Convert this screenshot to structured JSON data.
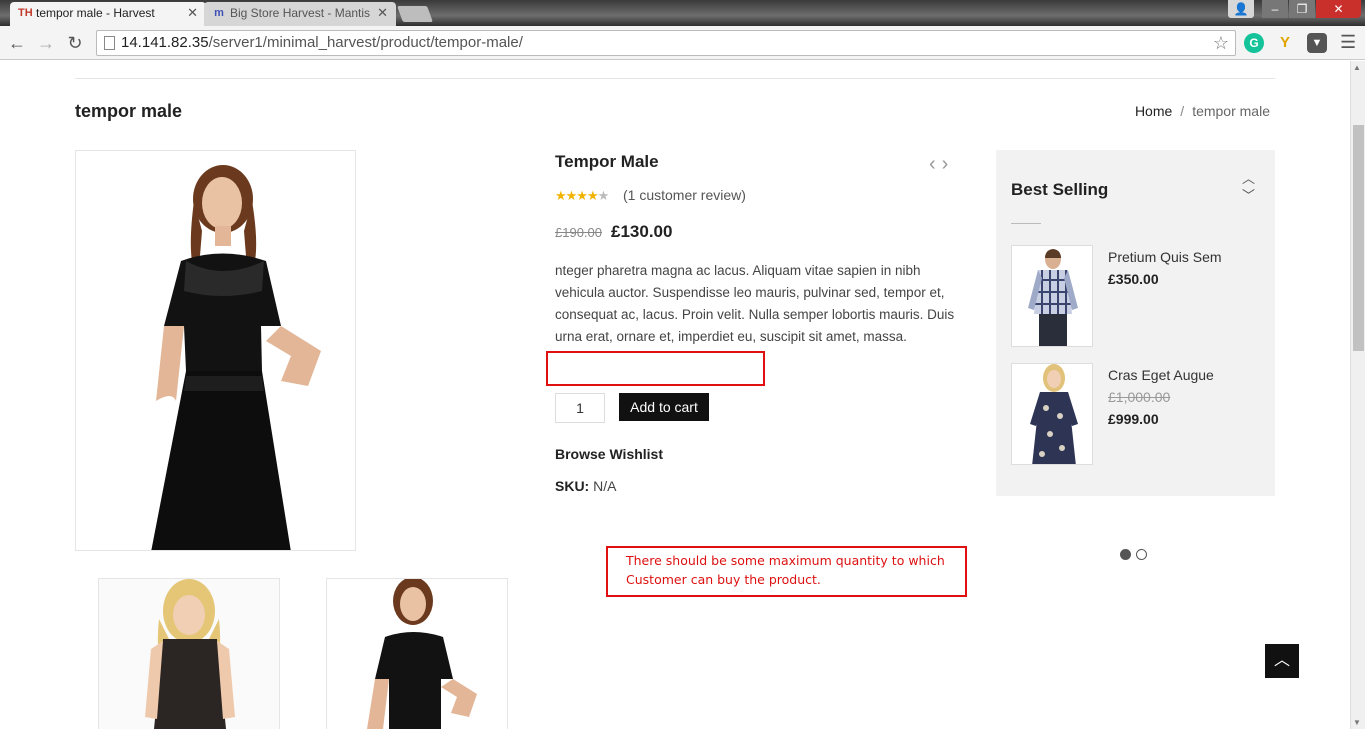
{
  "browser": {
    "tabs": [
      {
        "title": "tempor male - Harvest",
        "favicon": "TH"
      },
      {
        "title": "Big Store Harvest - Mantis",
        "favicon": "m"
      }
    ],
    "url": {
      "host": "14.141.82.35",
      "path": "/server1/minimal_harvest/product/tempor-male/"
    }
  },
  "page": {
    "title": "tempor male",
    "breadcrumb": {
      "home": "Home",
      "sep": "/",
      "current": "tempor male"
    }
  },
  "product": {
    "name": "Tempor Male",
    "rating": 4.5,
    "rating_stars": "★★★★",
    "rating_dim": "★",
    "reviews": "(1 customer review)",
    "price_old": "£190.00",
    "price_new": "£130.00",
    "description": "nteger pharetra magna ac lacus. Aliquam vitae sapien in nibh vehicula auctor. Suspendisse leo mauris, pulvinar sed, tempor et, consequat ac, lacus. Proin velit. Nulla semper lobortis mauris. Duis urna erat, ornare et, imperdiet eu, suscipit sit amet, massa.",
    "qty": "1",
    "add_to_cart": "Add to cart",
    "wishlist": "Browse Wishlist",
    "sku_label": "SKU:",
    "sku_value": "N/A"
  },
  "annotation": {
    "note": "There should be some maximum quantity to which Customer can buy the product.",
    "color": "#e01010"
  },
  "sidebar": {
    "title": "Best Selling",
    "items": [
      {
        "name": "Pretium Quis Sem",
        "price": "£350.00",
        "old_price": ""
      },
      {
        "name": "Cras Eget Augue",
        "price": "£999.00",
        "old_price": "£1,000.00"
      }
    ]
  },
  "colors": {
    "accent": "#111111",
    "star": "#f0b400",
    "sidebar_bg": "#f2f2f2"
  }
}
